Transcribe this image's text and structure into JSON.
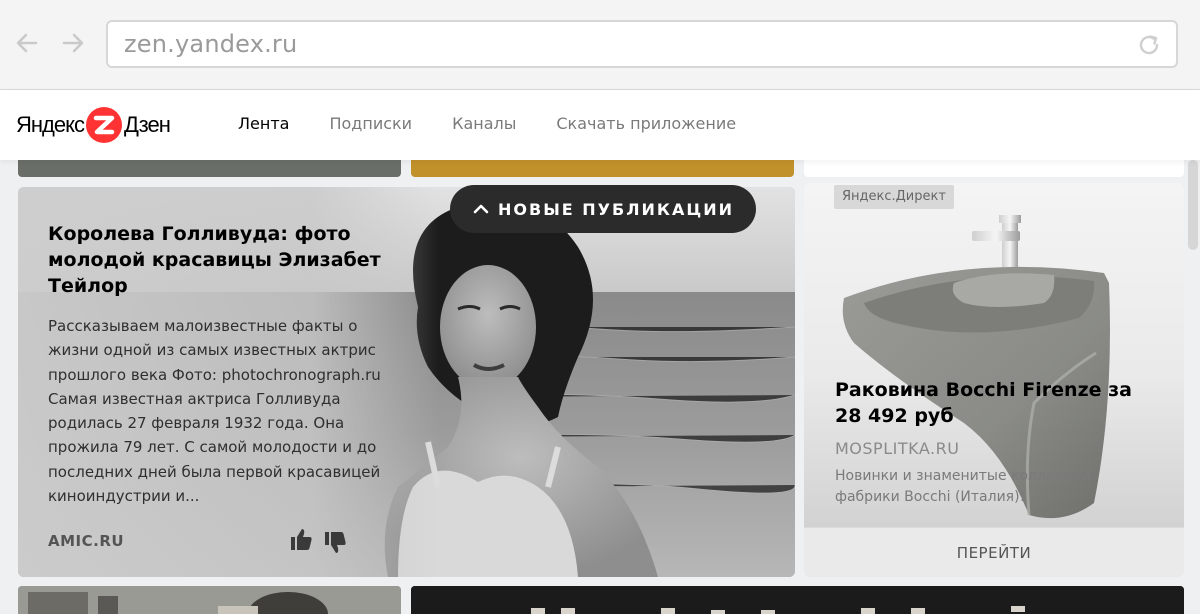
{
  "browser": {
    "url": "zen.yandex.ru"
  },
  "header": {
    "logo_left": "Яндекс",
    "logo_right": "Дзен",
    "nav": [
      {
        "label": "Лента",
        "active": true
      },
      {
        "label": "Подписки",
        "active": false
      },
      {
        "label": "Каналы",
        "active": false
      },
      {
        "label": "Скачать приложение",
        "active": false
      }
    ]
  },
  "new_publications": {
    "label": "НОВЫЕ ПУБЛИКАЦИИ",
    "icon": "chevron-up-icon"
  },
  "article": {
    "title": "Королева Голливуда: фото молодой красавицы Элизабет Тейлор",
    "text": "Рассказываем малоизвестные факты о жизни одной из самых известных актрис прошлого века Фото: photochronograph.ru Самая известная актриса Голливуда родилась 27 февраля 1932 года. Она прожила 79 лет. С самой молодости и до последних дней была первой красавицей киноиндустрии и...",
    "source": "AMIC.RU",
    "like_icon": "thumbs-up-icon",
    "dislike_icon": "thumbs-down-icon"
  },
  "ad": {
    "badge": "Яндекс.Директ",
    "title": "Раковина Bocchi Firenze за 28 492 руб",
    "domain": "MOSPLITKA.RU",
    "description": "Новинки и знаменитые коллекции фабрики Bocchi (Италия)!",
    "cta": "ПЕРЕЙТИ"
  },
  "colors": {
    "accent_red": "#ff3333",
    "strip_olive": "#6a6e68",
    "strip_gold": "#c1912b",
    "pill_dark": "#2b2b2b"
  }
}
